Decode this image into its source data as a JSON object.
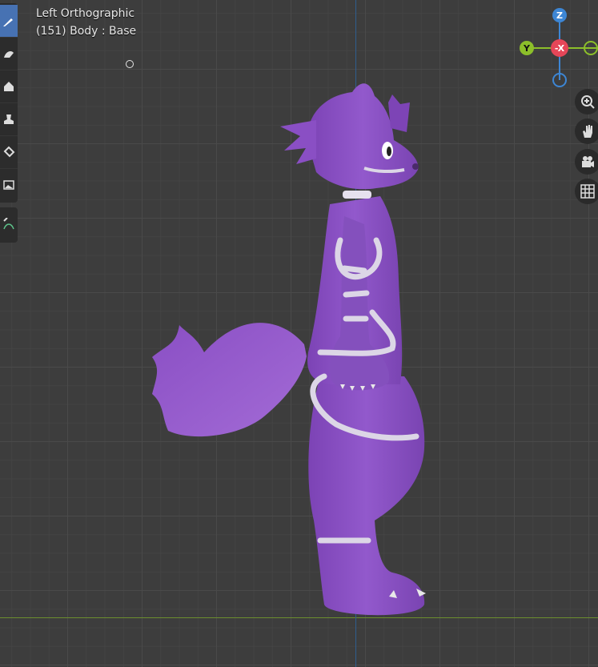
{
  "viewport": {
    "view_name": "Left Orthographic",
    "object_info": "(151) Body : Base"
  },
  "gizmo": {
    "z_label": "Z",
    "y_label": "Y",
    "neg_x_label": "-X",
    "colors": {
      "x": "#e54658",
      "y": "#8cbf2a",
      "z": "#3d86d4"
    }
  },
  "toolbar": {
    "tools": [
      "draw-tool",
      "smooth-tool",
      "mask-tool",
      "stamp-tool",
      "fill-tool",
      "image-tool"
    ],
    "active_tool": "draw-tool",
    "extra_tools": [
      "annotate-tool"
    ]
  },
  "nav_buttons": [
    "zoom-icon",
    "pan-hand-icon",
    "camera-icon",
    "grid-icon"
  ],
  "model": {
    "body_color": "#8a4fc4",
    "marking_color": "#dcd6e6"
  }
}
